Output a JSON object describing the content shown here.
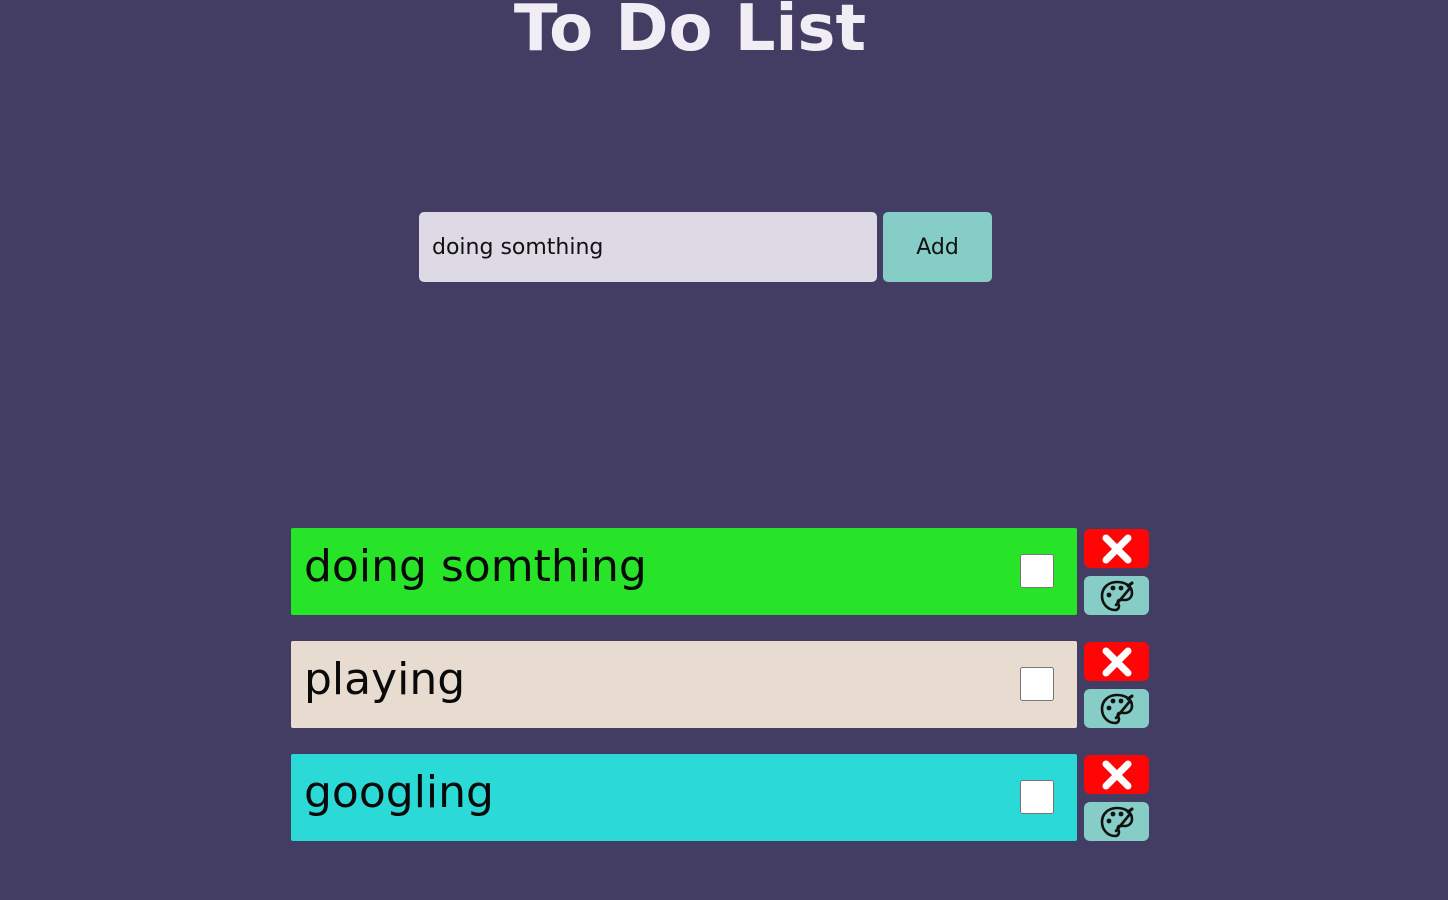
{
  "app": {
    "title": "To Do List"
  },
  "add_form": {
    "input_value": "doing somthing",
    "button_label": "Add"
  },
  "tasks": [
    {
      "text": "doing somthing",
      "color": "#28e428",
      "checked": false
    },
    {
      "text": "playing",
      "color": "#e8dcd0",
      "checked": false
    },
    {
      "text": "googling",
      "color": "#2bdad6",
      "checked": false
    }
  ],
  "colors": {
    "background": "#433c63",
    "input_background": "#ddd9e5",
    "add_button": "#85cdc6",
    "delete_button": "#ff0505",
    "color_button": "#85cdc6"
  },
  "icons": {
    "delete": "close-icon",
    "color": "palette-icon"
  }
}
